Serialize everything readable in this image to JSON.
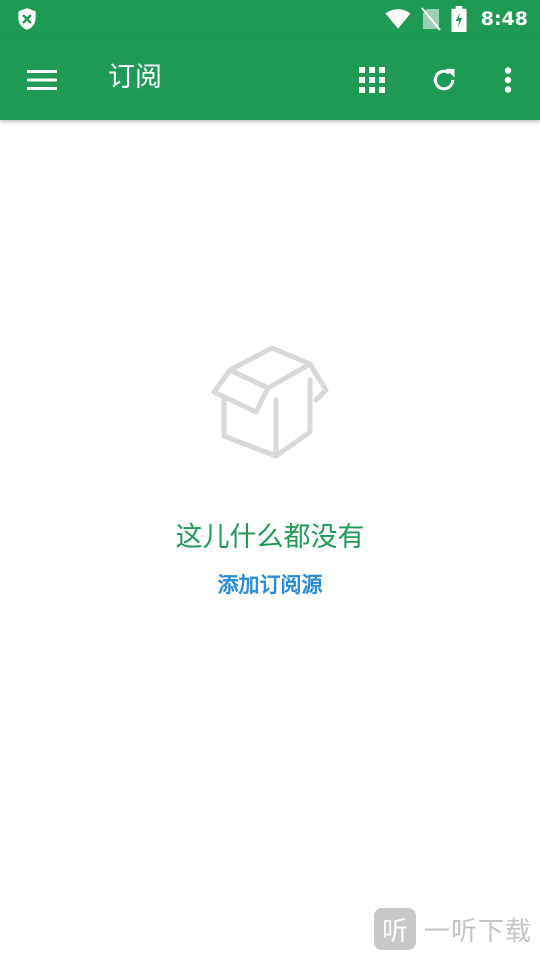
{
  "status_bar": {
    "time": "8:48"
  },
  "app_bar": {
    "title": "订阅",
    "icons": [
      "menu-icon",
      "grid-icon",
      "refresh-icon",
      "more-vert-icon"
    ]
  },
  "empty_state": {
    "icon": "empty-box-icon",
    "message": "这儿什么都没有",
    "action_label": "添加订阅源"
  },
  "watermark": {
    "logo_glyph": "听",
    "text": "一听下载"
  },
  "colors": {
    "primary": "#1e9a55",
    "link": "#2a8bd6",
    "icon_gray": "#d8d8d8"
  }
}
